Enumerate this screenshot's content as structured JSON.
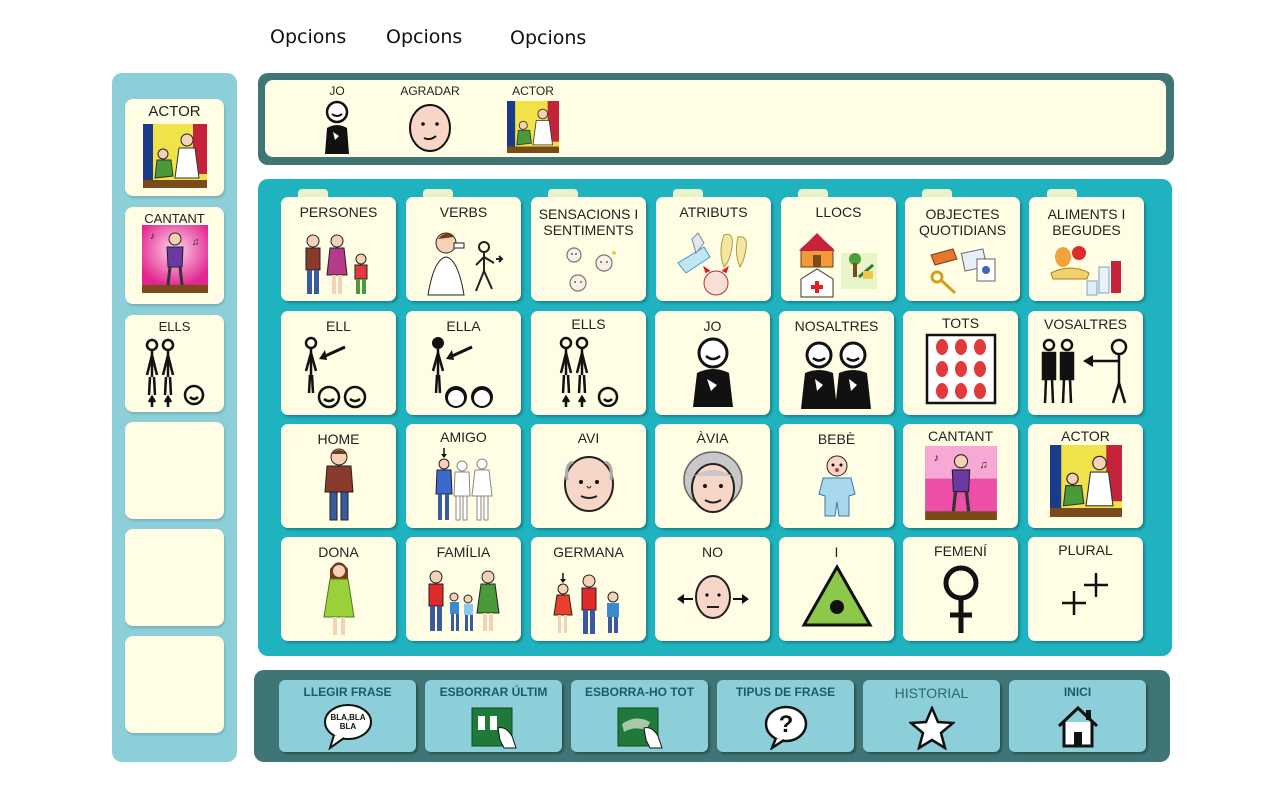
{
  "menu": {
    "items": [
      "Opcions",
      "Opcions",
      "Opcions"
    ]
  },
  "sidebar": {
    "items": [
      {
        "label": "ACTOR",
        "icon": "actor-icon"
      },
      {
        "label": "CANTANT",
        "icon": "singer-icon"
      },
      {
        "label": "ELLS",
        "icon": "them-icon"
      },
      {
        "label": "",
        "icon": ""
      },
      {
        "label": "",
        "icon": ""
      },
      {
        "label": "",
        "icon": ""
      }
    ]
  },
  "sentence": {
    "words": [
      {
        "label": "JO",
        "icon": "me-icon"
      },
      {
        "label": "AGRADAR",
        "icon": "like-face-icon"
      },
      {
        "label": "ACTOR",
        "icon": "actor-icon"
      }
    ]
  },
  "grid": {
    "rows": [
      [
        {
          "label": "PERSONES",
          "icon": "people-icon",
          "folder": true
        },
        {
          "label": "VERBS",
          "icon": "verbs-icon",
          "folder": true
        },
        {
          "label": "SENSACIONS I SENTIMENTS",
          "icon": "feelings-icon",
          "folder": true
        },
        {
          "label": "ATRIBUTS",
          "icon": "attributes-icon",
          "folder": true
        },
        {
          "label": "LLOCS",
          "icon": "places-icon",
          "folder": true
        },
        {
          "label": "OBJECTES QUOTIDIANS",
          "icon": "objects-icon",
          "folder": true
        },
        {
          "label": "ALIMENTS I BEGUDES",
          "icon": "food-icon",
          "folder": true
        }
      ],
      [
        {
          "label": "ELL",
          "icon": "him-icon"
        },
        {
          "label": "ELLA",
          "icon": "her-icon"
        },
        {
          "label": "ELLS",
          "icon": "them-icon"
        },
        {
          "label": "JO",
          "icon": "me-icon"
        },
        {
          "label": "NOSALTRES",
          "icon": "us-icon"
        },
        {
          "label": "TOTS",
          "icon": "all-icon"
        },
        {
          "label": "VOSALTRES",
          "icon": "you-plural-icon"
        }
      ],
      [
        {
          "label": "HOME",
          "icon": "man-icon"
        },
        {
          "label": "AMIGO",
          "icon": "friend-icon"
        },
        {
          "label": "AVI",
          "icon": "grandfather-icon"
        },
        {
          "label": "ÀVIA",
          "icon": "grandmother-icon"
        },
        {
          "label": "BEBÈ",
          "icon": "baby-icon"
        },
        {
          "label": "CANTANT",
          "icon": "singer-icon"
        },
        {
          "label": "ACTOR",
          "icon": "actor-icon"
        }
      ],
      [
        {
          "label": "DONA",
          "icon": "woman-icon"
        },
        {
          "label": "FAMÍLIA",
          "icon": "family-icon"
        },
        {
          "label": "GERMANA",
          "icon": "sister-icon"
        },
        {
          "label": "NO",
          "icon": "no-icon"
        },
        {
          "label": "I",
          "icon": "and-triangle-icon"
        },
        {
          "label": "FEMENÍ",
          "icon": "female-symbol-icon"
        },
        {
          "label": "PLURAL",
          "icon": "plural-icon"
        }
      ]
    ]
  },
  "bottom": {
    "buttons": [
      {
        "label": "LLEGIR FRASE",
        "icon": "speech-bubble-icon",
        "bubble_text": "BLA,BLA BLA"
      },
      {
        "label": "ESBORRAR ÚLTIM",
        "icon": "erase-last-icon"
      },
      {
        "label": "ESBORRA-HO TOT",
        "icon": "erase-all-icon"
      },
      {
        "label": "TIPUS DE FRASE",
        "icon": "question-icon"
      },
      {
        "label": "HISTORIAL",
        "icon": "star-icon"
      },
      {
        "label": "INICI",
        "icon": "home-icon"
      }
    ]
  },
  "colors": {
    "panel_teal": "#1eb3bf",
    "panel_dark": "#3f7575",
    "panel_light": "#8ccfd9",
    "card_bg": "#fffde3"
  }
}
